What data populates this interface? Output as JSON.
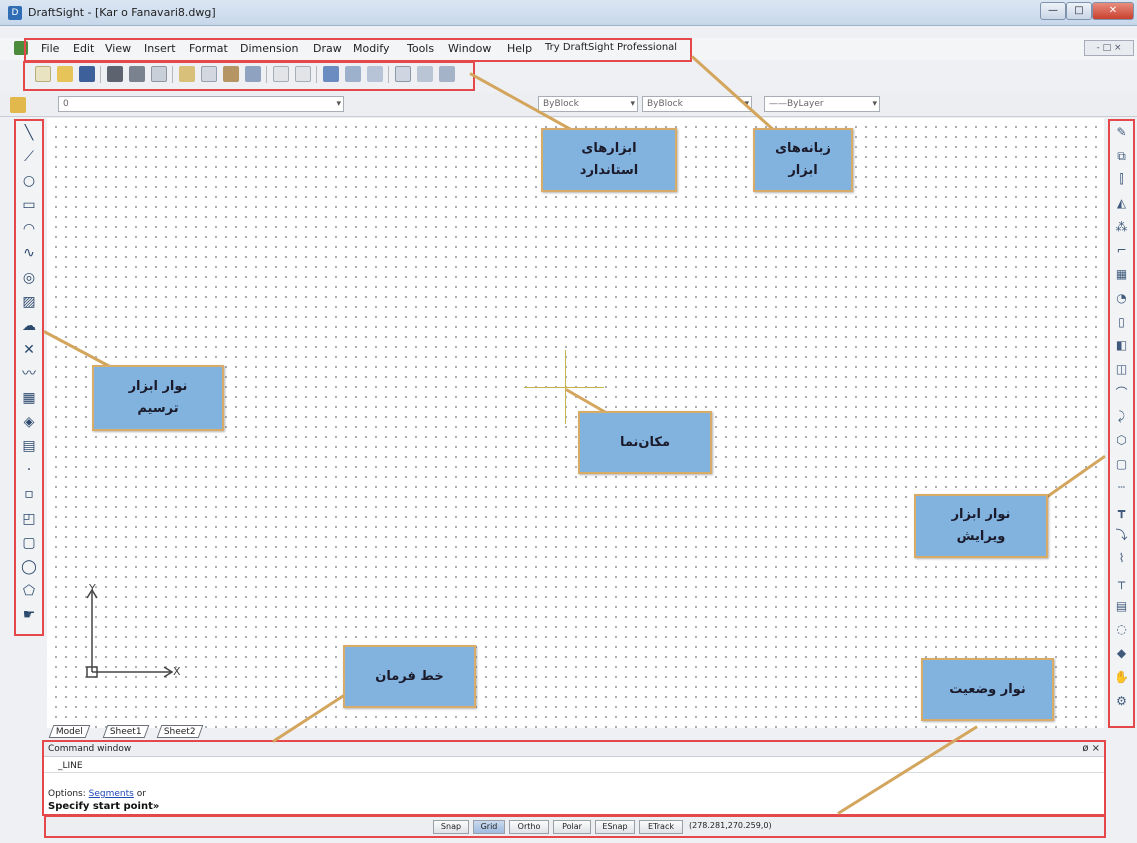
{
  "window": {
    "title": "DraftSight - [Kar o Fanavari8.dwg]",
    "controls": {
      "minimize": "—",
      "maximize": "□",
      "close": "✕"
    }
  },
  "menu": {
    "items": [
      "File",
      "Edit",
      "View",
      "Insert",
      "Format",
      "Dimension",
      "Draw",
      "Modify",
      "Tools",
      "Window",
      "Help",
      "Try DraftSight Professional"
    ],
    "mdi_controls": "- □ ×"
  },
  "property_bar": {
    "layer": "0",
    "color": "ByBlock",
    "linetype": "ByBlock",
    "lineweight": "——ByLayer"
  },
  "tabs": [
    "Model",
    "Sheet1",
    "Sheet2"
  ],
  "command_window": {
    "header": "Command window",
    "controls": "ø ×",
    "current_command": "_LINE",
    "options_label": "Options:",
    "options_keyword": "Segments",
    "options_suffix": "or",
    "prompt": "Specify start point»"
  },
  "status_bar": {
    "buttons": [
      {
        "label": "Snap",
        "active": false
      },
      {
        "label": "Grid",
        "active": true
      },
      {
        "label": "Ortho",
        "active": false
      },
      {
        "label": "Polar",
        "active": false
      },
      {
        "label": "ESnap",
        "active": false
      },
      {
        "label": "ETrack",
        "active": false
      }
    ],
    "coordinates": "(278.281,270.259,0)"
  },
  "ucs": {
    "x_label": "X",
    "y_label": "Y"
  },
  "callouts": {
    "standard_tools": {
      "line1": "ابزارهای",
      "line2": "استاندارد"
    },
    "menu_tabs": {
      "line1": "زبانه‌های",
      "line2": "ابزار"
    },
    "draw_toolbar": {
      "line1": "نوار ابزار",
      "line2": "ترسیم"
    },
    "cursor": {
      "line1": "مکان‌نما"
    },
    "modify_toolbar": {
      "line1": "نوار ابزار",
      "line2": "ویرایش"
    },
    "command_line": {
      "line1": "خط فرمان"
    },
    "status_bar": {
      "line1": "نوار وضعیت"
    }
  },
  "draw_tool_icons": [
    "line-icon",
    "polyline-icon",
    "circle-icon",
    "rectangle-icon",
    "arc-icon",
    "spline-icon",
    "ellipse-icon",
    "hatch-icon",
    "revision-cloud-icon",
    "infinite-line-icon",
    "freehand-icon",
    "table-icon",
    "block-icon",
    "insert-block-icon",
    "point-icon",
    "text-icon",
    "note-icon",
    "polygon-icon",
    "ring-icon",
    "region-icon"
  ],
  "modify_tool_icons": [
    "erase-icon",
    "copy-icon",
    "mirror-icon",
    "offset-icon",
    "pattern-icon",
    "move-icon",
    "rotate-icon",
    "scale-icon",
    "stretch-icon",
    "trim-icon",
    "extend-icon",
    "break-icon",
    "join-icon",
    "chamfer-icon",
    "fillet-icon",
    "explode-icon",
    "align-icon",
    "lengthen-icon",
    "split-icon",
    "weld-icon",
    "edit-polyline-icon",
    "edit-spline-icon",
    "edit-hatch-icon",
    "match-properties-icon",
    "properties-icon"
  ]
}
